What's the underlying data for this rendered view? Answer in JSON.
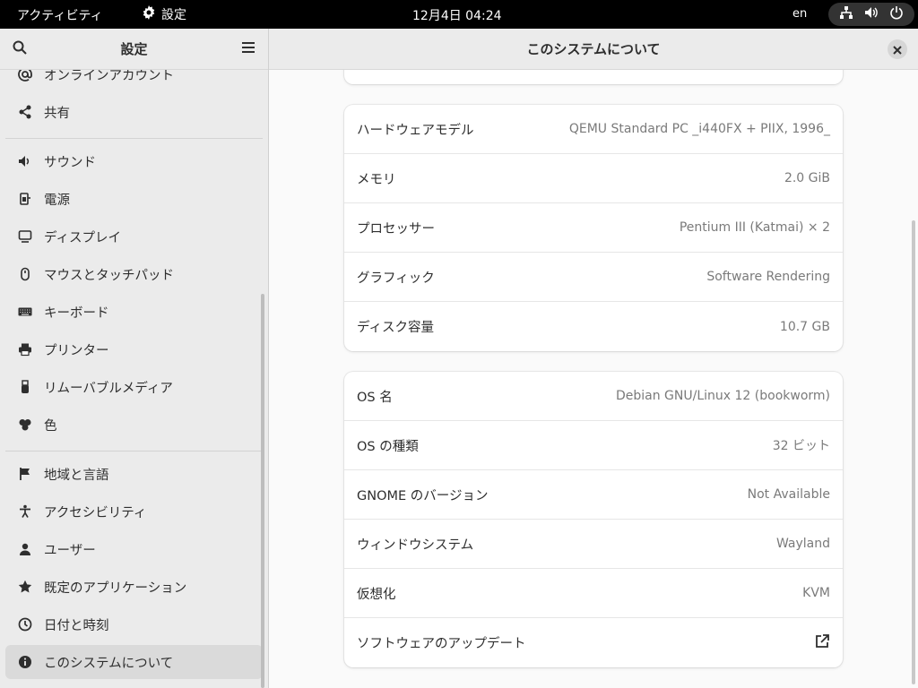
{
  "topbar": {
    "activities": "アクティビティ",
    "app_name": "設定",
    "clock": "12月4日  04:24",
    "language": "en"
  },
  "sidebar": {
    "title": "設定",
    "items": [
      {
        "label": "オンラインアカウント",
        "icon": "at-icon"
      },
      {
        "label": "共有",
        "icon": "share-icon"
      },
      {
        "label": "サウンド",
        "icon": "speaker-icon"
      },
      {
        "label": "電源",
        "icon": "power-plug-icon"
      },
      {
        "label": "ディスプレイ",
        "icon": "display-icon"
      },
      {
        "label": "マウスとタッチパッド",
        "icon": "mouse-icon"
      },
      {
        "label": "キーボード",
        "icon": "keyboard-icon"
      },
      {
        "label": "プリンター",
        "icon": "printer-icon"
      },
      {
        "label": "リムーバブルメディア",
        "icon": "usb-icon"
      },
      {
        "label": "色",
        "icon": "color-icon"
      },
      {
        "label": "地域と言語",
        "icon": "flag-icon"
      },
      {
        "label": "アクセシビリティ",
        "icon": "accessibility-icon"
      },
      {
        "label": "ユーザー",
        "icon": "users-icon"
      },
      {
        "label": "既定のアプリケーション",
        "icon": "star-icon"
      },
      {
        "label": "日付と時刻",
        "icon": "clock-icon"
      },
      {
        "label": "このシステムについて",
        "icon": "info-icon"
      }
    ]
  },
  "main": {
    "title": "このシステムについて",
    "hardware": [
      {
        "label": "ハードウェアモデル",
        "value": "QEMU Standard PC _i440FX + PIIX, 1996_"
      },
      {
        "label": "メモリ",
        "value": "2.0 GiB"
      },
      {
        "label": "プロセッサー",
        "value": "Pentium III (Katmai) × 2"
      },
      {
        "label": "グラフィック",
        "value": "Software Rendering"
      },
      {
        "label": "ディスク容量",
        "value": "10.7 GB"
      }
    ],
    "software": [
      {
        "label": "OS 名",
        "value": "Debian GNU/Linux 12 (bookworm)"
      },
      {
        "label": "OS の種類",
        "value": "32 ビット"
      },
      {
        "label": "GNOME のバージョン",
        "value": "Not Available"
      },
      {
        "label": "ウィンドウシステム",
        "value": "Wayland"
      },
      {
        "label": "仮想化",
        "value": "KVM"
      }
    ],
    "updates_label": "ソフトウェアのアップデート"
  },
  "colors": {
    "topbar": "#000000",
    "sidebar_bg": "#ebebeb",
    "active_item": "#dadada",
    "card_bg": "#ffffff",
    "value_text": "#7a7a7a"
  }
}
